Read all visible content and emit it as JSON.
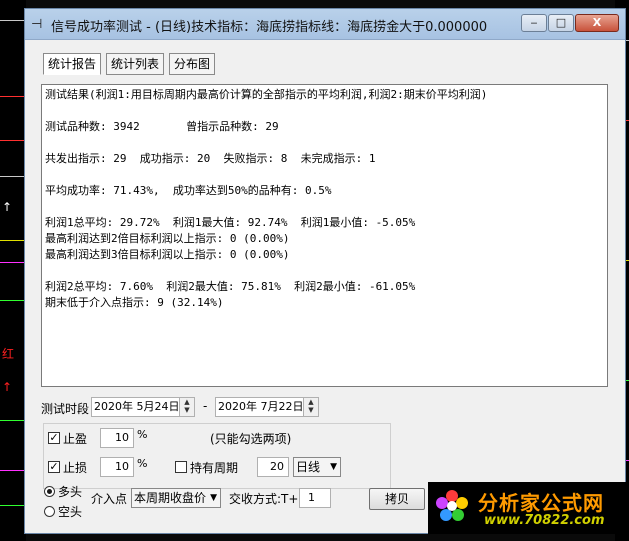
{
  "title": {
    "icon": "chart-icon",
    "text": "信号成功率测试 - (日线)技术指标：海底捞指标线：海底捞金大于0.000000"
  },
  "window_controls": {
    "minimize": "‒",
    "maximize": "□",
    "close": "X"
  },
  "tabs": [
    "统计报告",
    "统计列表",
    "分布图"
  ],
  "report_lines": [
    "测试结果(利润1:用目标周期内最高价计算的全部指示的平均利润,利润2:期末价平均利润)",
    "",
    "测试品种数: 3942       曾指示品种数: 29",
    "",
    "共发出指示: 29  成功指示: 20  失败指示: 8  未完成指示: 1",
    "",
    "平均成功率: 71.43%,  成功率达到50%的品种有: 0.5%",
    "",
    "利润1总平均: 29.72%  利润1最大值: 92.74%  利润1最小值: -5.05%",
    "最高利润达到2倍目标利润以上指示: 0 (0.00%)",
    "最高利润达到3倍目标利润以上指示: 0 (0.00%)",
    "",
    "利润2总平均: 7.60%  利润2最大值: 75.81%  利润2最小值: -61.05%",
    "期末低于介入点指示: 9 (32.14%)"
  ],
  "period": {
    "label": "测试时段",
    "start": "2020年 5月24日",
    "separator": "-",
    "end": "2020年 7月22日"
  },
  "options": {
    "stop_profit": {
      "label": "止盈",
      "value": "10",
      "unit": "%",
      "checked": true
    },
    "stop_loss": {
      "label": "止损",
      "value": "10",
      "unit": "%",
      "checked": true
    },
    "note": "(只能勾选两项)",
    "hold_period": {
      "label": "持有周期",
      "value": "20",
      "checked": false
    },
    "period_type": "日线"
  },
  "direction": {
    "long": "多头",
    "short": "空头",
    "selected": "long"
  },
  "entry": {
    "label": "介入点",
    "value": "本周期收盘价"
  },
  "trade": {
    "label": "交收方式:T+",
    "value": "1"
  },
  "copy_button": "拷贝",
  "watermark": {
    "name": "分析家公式网",
    "url": "www.70822.com"
  }
}
